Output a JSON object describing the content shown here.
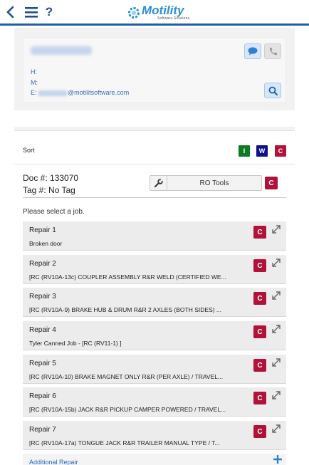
{
  "header": {
    "logo_text": "Motility",
    "logo_subtext": "Software Solutions",
    "icons": [
      "chevron-left-icon",
      "hamburger-menu-icon",
      "help-icon"
    ],
    "help_glyph": "?"
  },
  "contact": {
    "home_label": "H:",
    "mobile_label": "M:",
    "email_label": "E:",
    "email_domain": "@motilitsoftware.com",
    "icons": [
      "chat-icon",
      "phone-icon",
      "search-icon"
    ]
  },
  "sort": {
    "label": "Sort",
    "buttons": [
      {
        "label": "I",
        "color": "#0f7a1f"
      },
      {
        "label": "W",
        "color": "#0e0f8a"
      },
      {
        "label": "C",
        "color": "#b0123a"
      }
    ]
  },
  "document": {
    "doc_label": "Doc #: 133070",
    "tag_label": "Tag #: No Tag",
    "ro_tools_label": "RO Tools",
    "c_label": "C"
  },
  "jobs": {
    "prompt": "Please select a job.",
    "c_label": "C",
    "items": [
      {
        "title": "Repair 1",
        "description": "Broken door"
      },
      {
        "title": "Repair 2",
        "description": "[RC (RV10A-13c) COUPLER ASSEMBLY R&R WELD (CERTIFIED WE..."
      },
      {
        "title": "Repair 3",
        "description": "[RC (RV10A-9) BRAKE HUB & DRUM R&R 2 AXLES (BOTH SIDES) ..."
      },
      {
        "title": "Repair 4",
        "description": "Tyler Canned Job - [RC (RV11-1) ]"
      },
      {
        "title": "Repair 5",
        "description": "[RC (RV10A-10) BRAKE MAGNET ONLY R&R (PER AXLE) / TRAVEL..."
      },
      {
        "title": "Repair 6",
        "description": "[RC (RV10A-15b) JACK R&R PICKUP CAMPER POWERED / TRAVEL..."
      },
      {
        "title": "Repair 7",
        "description": "[RC (RV10A-17a) TONGUE JACK R&R TRAILER MANUAL TYPE / T..."
      }
    ],
    "additional_label": "Additional Repair"
  },
  "colors": {
    "accent_blue": "#1f5fa8",
    "link_blue": "#2f68b9",
    "c_red": "#b0123a"
  }
}
